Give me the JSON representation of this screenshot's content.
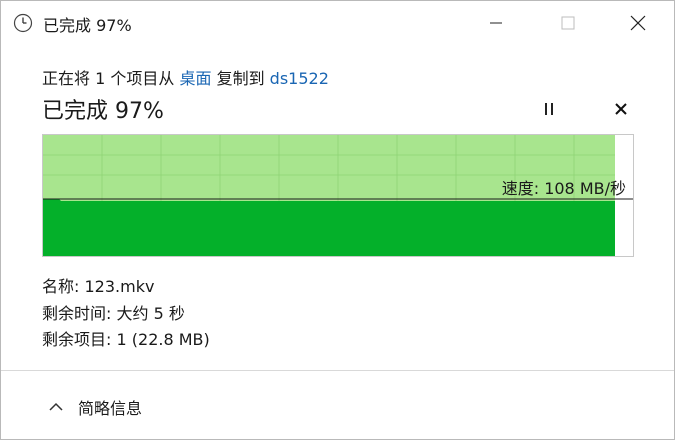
{
  "window": {
    "title": "已完成 97%",
    "icon": "clock-icon",
    "controls": [
      "minimize-icon",
      "maximize-icon",
      "close-icon"
    ]
  },
  "transfer": {
    "prefix": "正在将 1 个项目从",
    "source": "桌面",
    "middle": "复制到",
    "destination": "ds1522"
  },
  "heading": "已完成 97%",
  "progress": {
    "percent": 97,
    "speed_label": "速度: 108 MB/秒",
    "colors": {
      "done_fill": "#a8e58e",
      "speed_fill": "#04b02a",
      "grid": "#8fd475",
      "line": "#1a1a1a"
    }
  },
  "buttons": {
    "pause_icon": "pause-icon",
    "stop_icon": "stop-icon"
  },
  "details": {
    "name_label": "名称:",
    "name_value": "123.mkv",
    "time_label": "剩余时间:",
    "time_value": "大约 5 秒",
    "items_label": "剩余项目:",
    "items_value": "1 (22.8 MB)"
  },
  "footer": {
    "toggle_label": "简略信息",
    "toggle_icon": "chevron-up-icon"
  }
}
